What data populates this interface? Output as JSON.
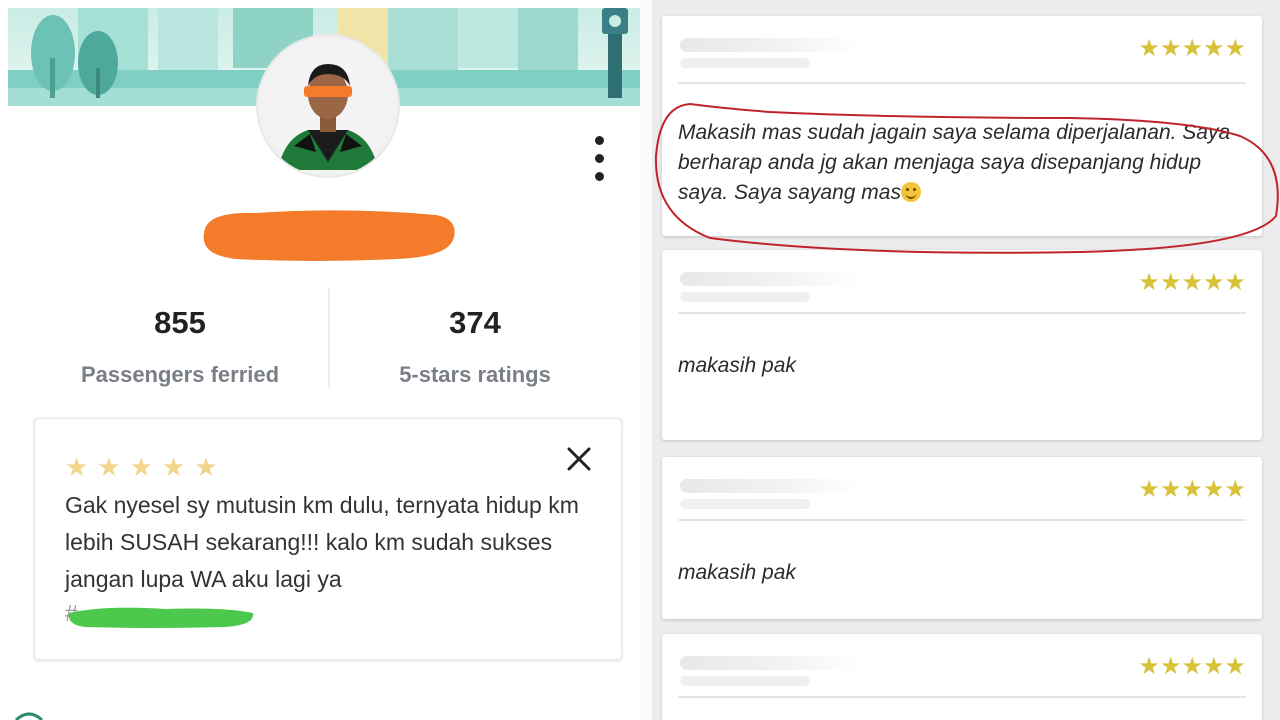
{
  "profile": {
    "stats": [
      {
        "value": "855",
        "label": "Passengers ferried"
      },
      {
        "value": "374",
        "label": "5-stars ratings"
      }
    ],
    "review": {
      "stars": "★★★★★",
      "rating": 5,
      "text": "Gak nyesel sy mutusin km dulu, ternyata hidup km lebih SUSAH sekarang!!! kalo km sudah sukses jangan lupa WA aku lagi ya",
      "hashtag": "#"
    },
    "icons": [
      "more-vertical-icon",
      "close-icon"
    ]
  },
  "feedback": {
    "cards": [
      {
        "stars": "★★★★★",
        "rating": 5,
        "comment": "Makasih mas sudah jagain saya selama diperjalanan. Saya berharap anda jg akan menjaga saya disepanjang hidup saya. Saya sayang mas"
      },
      {
        "stars": "★★★★★",
        "rating": 5,
        "comment": "makasih pak"
      },
      {
        "stars": "★★★★★",
        "rating": 5,
        "comment": "makasih pak"
      },
      {
        "stars": "★★★★★",
        "rating": 5,
        "comment": ""
      }
    ],
    "highlight_color": "#c0242b"
  },
  "colors": {
    "rating_star_light": "#f0d78c",
    "rating_star_gold": "#d7c23a",
    "redaction_orange": "#f47b2a",
    "redaction_green": "#4cc94c",
    "banner_teal": "#7fcfc4"
  }
}
